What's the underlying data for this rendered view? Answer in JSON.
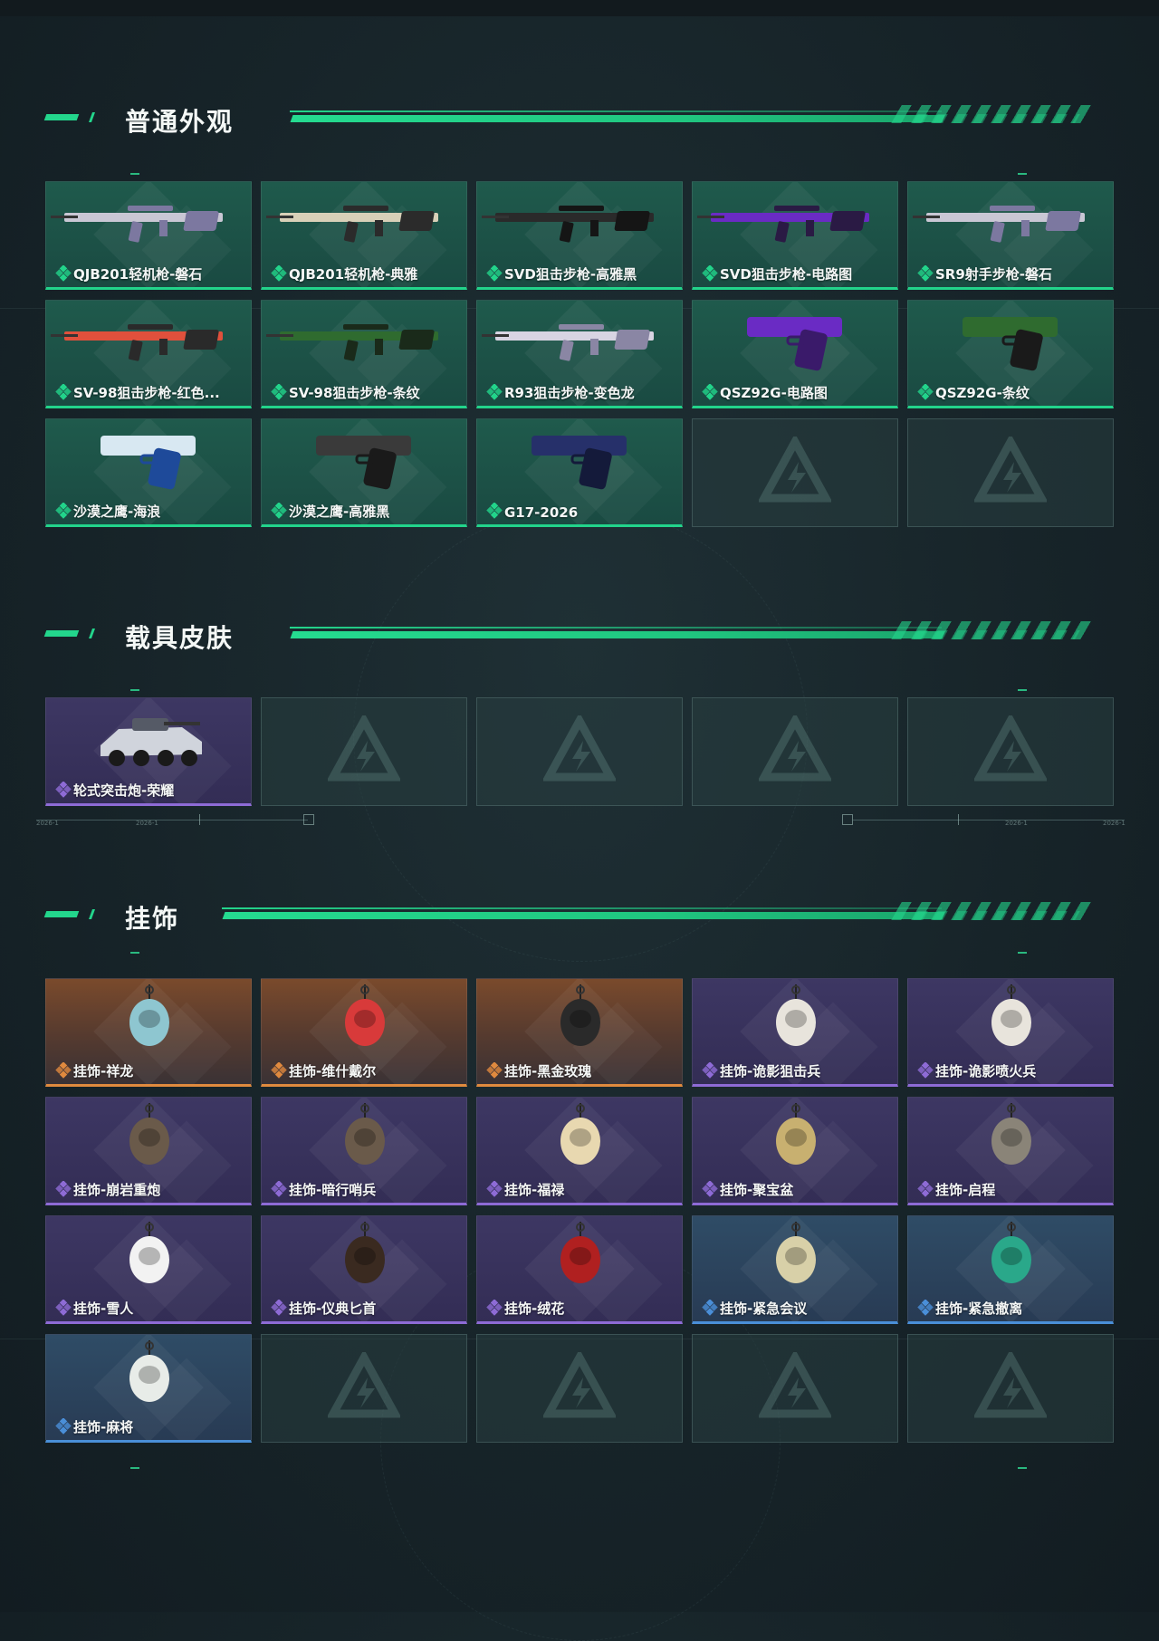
{
  "sections": [
    {
      "title": "普通外观",
      "items": [
        {
          "name": "QJB201轻机枪-磐石",
          "rarity": "green",
          "icon": "rifle-camo-icon"
        },
        {
          "name": "QJB201轻机枪-典雅",
          "rarity": "green",
          "icon": "rifle-tan-icon"
        },
        {
          "name": "SVD狙击步枪-高雅黑",
          "rarity": "green",
          "icon": "sniper-black-icon"
        },
        {
          "name": "SVD狙击步枪-电路图",
          "rarity": "green",
          "icon": "sniper-purple-icon"
        },
        {
          "name": "SR9射手步枪-磐石",
          "rarity": "green",
          "icon": "rifle-camo-icon"
        },
        {
          "name": "SV-98狙击步枪-红色...",
          "rarity": "green",
          "icon": "sniper-red-icon"
        },
        {
          "name": "SV-98狙击步枪-条纹",
          "rarity": "green",
          "icon": "sniper-green-icon"
        },
        {
          "name": "R93狙击步枪-变色龙",
          "rarity": "green",
          "icon": "sniper-white-icon"
        },
        {
          "name": "QSZ92G-电路图",
          "rarity": "green",
          "icon": "pistol-purple-icon"
        },
        {
          "name": "QSZ92G-条纹",
          "rarity": "green",
          "icon": "pistol-green-icon"
        },
        {
          "name": "沙漠之鹰-海浪",
          "rarity": "green",
          "icon": "pistol-wave-icon"
        },
        {
          "name": "沙漠之鹰-高雅黑",
          "rarity": "green",
          "icon": "pistol-black-icon"
        },
        {
          "name": "G17-2026",
          "rarity": "green",
          "icon": "pistol-navy-icon"
        }
      ]
    },
    {
      "title": "载具皮肤",
      "items": [
        {
          "name": "轮式突击炮-荣耀",
          "rarity": "purple",
          "icon": "vehicle-icon"
        }
      ]
    },
    {
      "title": "挂饰",
      "items": [
        {
          "name": "挂饰-祥龙",
          "rarity": "orange",
          "icon": "dragon-charm-icon"
        },
        {
          "name": "挂饰-维什戴尔",
          "rarity": "orange",
          "icon": "figure-charm-icon"
        },
        {
          "name": "挂饰-黑金玫瑰",
          "rarity": "orange",
          "icon": "rose-charm-icon"
        },
        {
          "name": "挂饰-诡影狙击兵",
          "rarity": "purple",
          "icon": "soldier-charm-icon"
        },
        {
          "name": "挂饰-诡影喷火兵",
          "rarity": "purple",
          "icon": "soldier-charm-icon"
        },
        {
          "name": "挂饰-崩岩重炮",
          "rarity": "purple",
          "icon": "bear-charm-icon"
        },
        {
          "name": "挂饰-暗行哨兵",
          "rarity": "purple",
          "icon": "bear-charm-icon"
        },
        {
          "name": "挂饰-福禄",
          "rarity": "purple",
          "icon": "gourd-charm-icon"
        },
        {
          "name": "挂饰-聚宝盆",
          "rarity": "purple",
          "icon": "treasure-charm-icon"
        },
        {
          "name": "挂饰-启程",
          "rarity": "purple",
          "icon": "badge-charm-icon"
        },
        {
          "name": "挂饰-雪人",
          "rarity": "purple",
          "icon": "snowman-charm-icon"
        },
        {
          "name": "挂饰-仪典匕首",
          "rarity": "purple",
          "icon": "dagger-charm-icon"
        },
        {
          "name": "挂饰-绒花",
          "rarity": "purple",
          "icon": "flower-charm-icon"
        },
        {
          "name": "挂饰-紧急会议",
          "rarity": "blue",
          "icon": "robot-charm-icon"
        },
        {
          "name": "挂饰-紧急撤离",
          "rarity": "blue",
          "icon": "exit-charm-icon"
        },
        {
          "name": "挂饰-麻将",
          "rarity": "blue",
          "icon": "mahjong-charm-icon"
        }
      ]
    }
  ],
  "divider_labels": [
    "2026-1",
    "2026-1",
    "2026-1",
    "2026-1"
  ],
  "colors": {
    "accent": "#23d68c",
    "green": "#22d48b",
    "purple": "#8e6bd6",
    "orange": "#e08a3e",
    "blue": "#4a8fd8"
  }
}
